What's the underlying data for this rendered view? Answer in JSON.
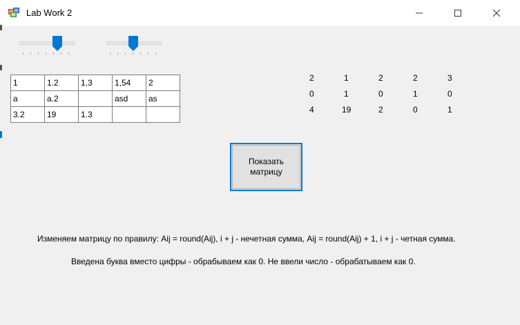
{
  "window": {
    "title": "Lab Work 2"
  },
  "sliders": [
    {
      "name": "slider-1",
      "value": 0.75
    },
    {
      "name": "slider-2",
      "value": 0.5
    }
  ],
  "grid": {
    "rows": [
      [
        "1",
        "1.2",
        "1,3",
        "1,54",
        "2"
      ],
      [
        "a",
        "a.2",
        "",
        "asd",
        "as"
      ],
      [
        "3.2",
        "19",
        "1.3",
        "",
        ""
      ]
    ]
  },
  "matrix": {
    "rows": [
      [
        "2",
        "1",
        "2",
        "2",
        "3"
      ],
      [
        "0",
        "1",
        "0",
        "1",
        "0"
      ],
      [
        "4",
        "19",
        "2",
        "0",
        "1"
      ]
    ]
  },
  "button": {
    "label": "Показать\nматрицу"
  },
  "notes": {
    "rule": "Изменяем матрицу по правилу: Aij = round(Aij), i + j - нечетная сумма, Aij = round(Aij) + 1, i + j - четная сумма.",
    "input_note": "Введена буква вместо цифры - обрабываем как 0. Не ввели число - обрабатываем как 0."
  },
  "colors": {
    "accent": "#0078d7",
    "window_bg": "#f0f0f0",
    "titlebar_bg": "#ffffff"
  }
}
